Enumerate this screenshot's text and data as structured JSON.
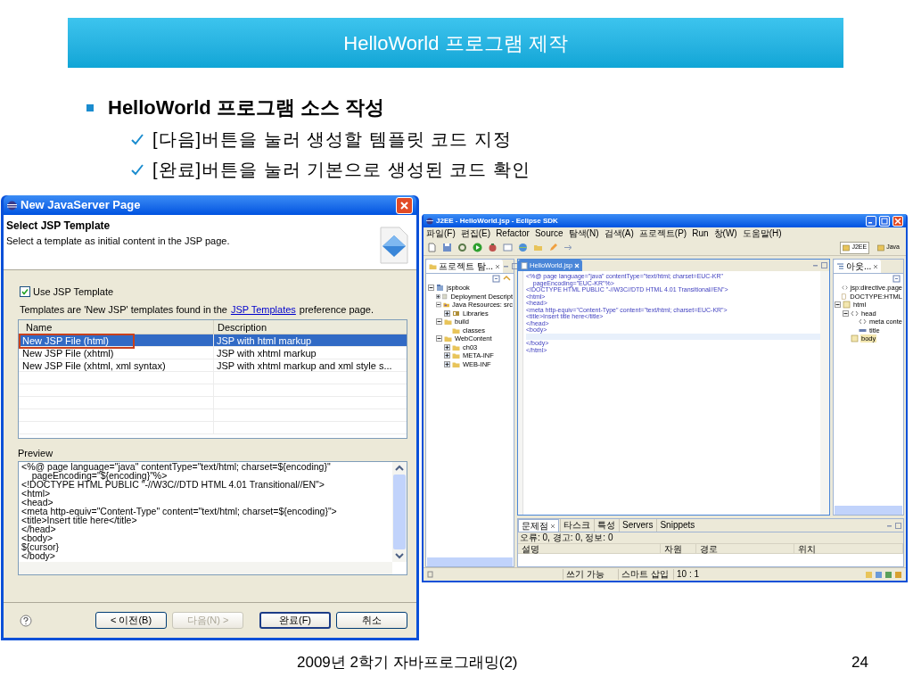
{
  "slide": {
    "title": "HelloWorld 프로그램 제작",
    "bullets": [
      {
        "text": "HelloWorld 프로그램 소스 작성",
        "children": [
          {
            "text": "[다음]버튼을 눌러 생성할 템플릿 코드 지정"
          },
          {
            "text": "[완료]버튼을 눌러 기본으로 생성된 코드 확인"
          }
        ]
      }
    ],
    "footer": {
      "course": "2009년 2학기 자바프로그래밍(2)",
      "page": "24"
    }
  },
  "dialog": {
    "title": "New JavaServer Page",
    "heading": "Select JSP Template",
    "description": "Select a template as initial content in the JSP page.",
    "use_template": {
      "label": "Use JSP Template",
      "checked": true
    },
    "note_before": "Templates are 'New JSP' templates found in the",
    "note_link": "JSP Templates",
    "note_after": "preference page.",
    "columns": [
      "Name",
      "Description"
    ],
    "rows": [
      {
        "name": "New JSP File (html)",
        "description": "JSP with html markup",
        "selected": true
      },
      {
        "name": "New JSP File (xhtml)",
        "description": "JSP with xhtml markup",
        "selected": false
      },
      {
        "name": "New JSP File (xhtml, xml syntax)",
        "description": "JSP with xhtml markup and xml style s...",
        "selected": false
      }
    ],
    "preview_label": "Preview",
    "preview_lines": [
      "<%@ page language=\"java\" contentType=\"text/html; charset=${encoding}\"",
      "    pageEncoding=\"${encoding}\"%>",
      "<!DOCTYPE HTML PUBLIC \"-//W3C//DTD HTML 4.01 Transitional//EN\">",
      "<html>",
      "<head>",
      "<meta http-equiv=\"Content-Type\" content=\"text/html; charset=${encoding}\">",
      "<title>Insert title here</title>",
      "</head>",
      "<body>",
      "${cursor}",
      "</body>"
    ],
    "buttons": [
      {
        "label": "< 이전(B)",
        "disabled": false,
        "default": false
      },
      {
        "label": "다음(N) >",
        "disabled": true,
        "default": false
      },
      {
        "label": "완료(F)",
        "disabled": false,
        "default": true
      },
      {
        "label": "취소",
        "disabled": false,
        "default": false
      }
    ]
  },
  "eclipse": {
    "title": "J2EE - HelloWorld.jsp - Eclipse SDK",
    "menu": [
      "파일(F)",
      "편집(E)",
      "Refactor",
      "Source",
      "탐색(N)",
      "검색(A)",
      "프로젝트(P)",
      "Run",
      "창(W)",
      "도움말(H)"
    ],
    "perspectives": [
      {
        "label": "J2EE",
        "selected": true
      },
      {
        "label": "Java",
        "selected": false
      }
    ],
    "explorer": {
      "tab": "프로젝트 탐...",
      "tree": [
        {
          "label": "jspbook",
          "kind": "project",
          "expanded": true,
          "children": [
            {
              "label": "Deployment Descript",
              "kind": "descriptor",
              "expanded": false
            },
            {
              "label": "Java Resources: src",
              "kind": "source",
              "expanded": true,
              "children": [
                {
                  "label": "Libraries",
                  "kind": "library",
                  "expanded": false
                }
              ]
            },
            {
              "label": "build",
              "kind": "folder",
              "expanded": true,
              "children": [
                {
                  "label": "classes",
                  "kind": "folder"
                }
              ]
            },
            {
              "label": "WebContent",
              "kind": "folder",
              "expanded": true,
              "children": [
                {
                  "label": "ch03",
                  "kind": "folder",
                  "expanded": false
                },
                {
                  "label": "META-INF",
                  "kind": "folder",
                  "expanded": false
                },
                {
                  "label": "WEB-INF",
                  "kind": "folder",
                  "expanded": false
                }
              ]
            }
          ]
        }
      ]
    },
    "editor": {
      "tab": "HelloWorld.jsp",
      "lines": [
        {
          "text": "<%@ page language=\"java\" contentType=\"text/html; charset=EUC-KR\"",
          "current": false
        },
        {
          "text": "    pageEncoding=\"EUC-KR\"%>",
          "current": false
        },
        {
          "text": "<!DOCTYPE HTML PUBLIC \"-//W3C//DTD HTML 4.01 Transitional//EN\">",
          "current": false
        },
        {
          "text": "<html>",
          "current": false
        },
        {
          "text": "<head>",
          "current": false
        },
        {
          "text": "<meta http-equiv=\"Content-Type\" content=\"text/html; charset=EUC-KR\">",
          "current": false
        },
        {
          "text": "<title>Insert title here</title>",
          "current": false
        },
        {
          "text": "</head>",
          "current": false
        },
        {
          "text": "<body>",
          "current": false
        },
        {
          "current": true
        },
        {
          "text": "</body>",
          "current": false
        },
        {
          "text": "</html>",
          "current": false
        }
      ]
    },
    "outline": {
      "tab": "아웃...",
      "tree": [
        {
          "label": "jsp:directive.page",
          "kind": "tag"
        },
        {
          "label": "DOCTYPE:HTML",
          "kind": "doctype"
        },
        {
          "label": "html",
          "kind": "element",
          "expanded": true,
          "children": [
            {
              "label": "head",
              "kind": "tag",
              "expanded": true,
              "children": [
                {
                  "label": "meta conte",
                  "kind": "tag"
                },
                {
                  "label": "title",
                  "kind": "text"
                }
              ]
            },
            {
              "label": "body",
              "kind": "element",
              "selected": true
            }
          ]
        }
      ]
    },
    "problems": {
      "tabs": [
        {
          "label": "문제점",
          "selected": true
        },
        {
          "label": "타스크",
          "selected": false
        },
        {
          "label": "특성",
          "selected": false
        },
        {
          "label": "Servers",
          "selected": false
        },
        {
          "label": "Snippets",
          "selected": false
        }
      ],
      "summary": "오류: 0, 경고: 0, 정보: 0",
      "columns": [
        "설명",
        "자원",
        "경로",
        "위치"
      ]
    },
    "status": [
      "쓰기 가능",
      "스마트 삽입",
      "10 : 1"
    ]
  }
}
